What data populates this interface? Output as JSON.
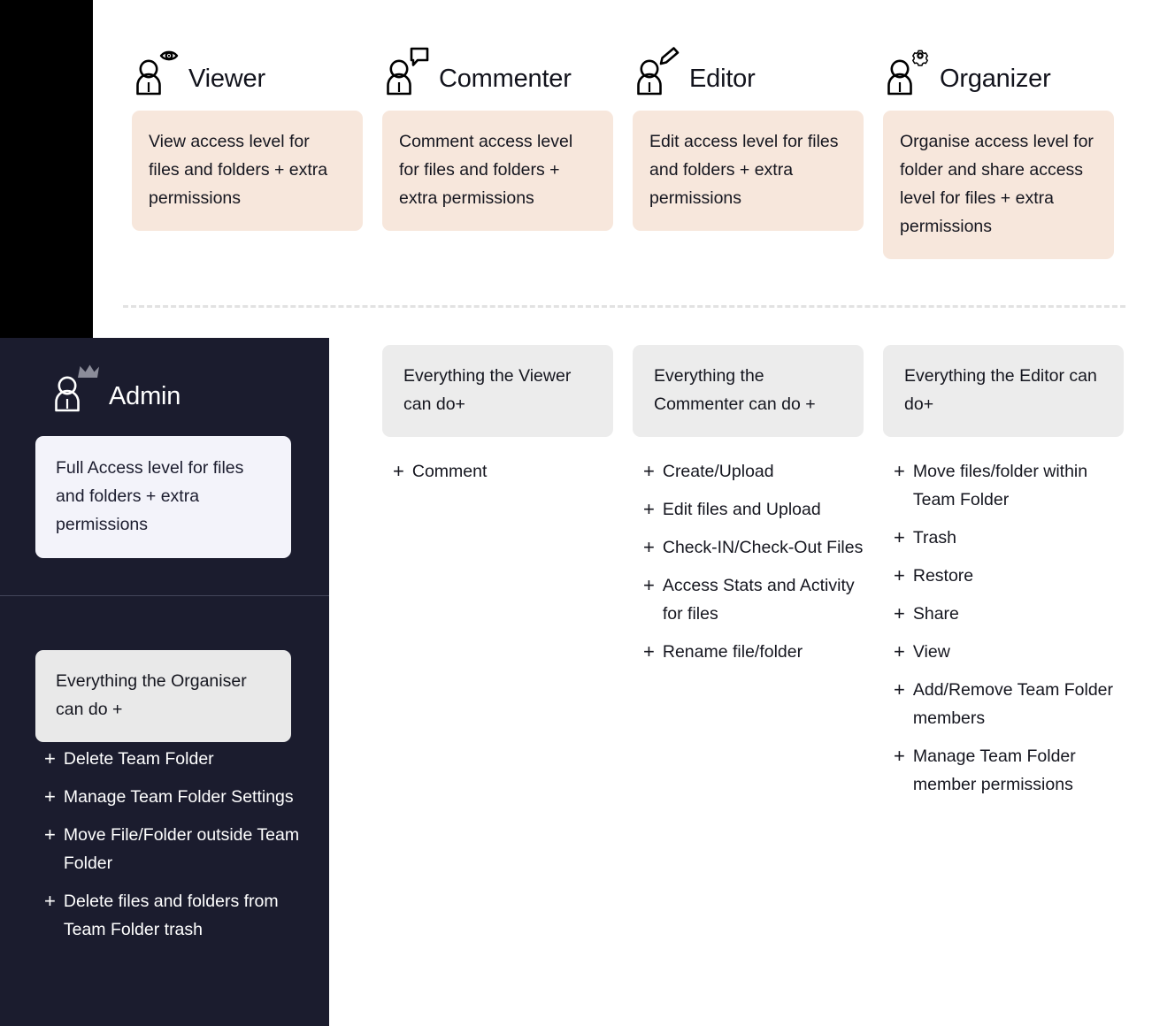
{
  "theme": {
    "black_block": "#000000",
    "panel_navy": "#1b1c2e",
    "peach_card": "#f7e7dc",
    "gray_card": "#ececec",
    "lavender_card": "#f3f3fa",
    "text_dark": "#15161f",
    "text_light": "#ffffff",
    "dashed_line": "#e2e2e2",
    "crown_gray": "#8b8c99"
  },
  "admin": {
    "icon": "person-crown-icon",
    "title": "Admin",
    "description": "Full Access level for files and folders + extra permissions",
    "inherits": "Everything the Organiser can do +",
    "permissions": [
      "Delete Team Folder",
      "Manage Team Folder Settings",
      "Move File/Folder outside Team Folder",
      "Delete files and folders from Team Folder trash"
    ]
  },
  "roles": [
    {
      "icon": "person-eye-icon",
      "title": "Viewer",
      "description": "View access level for files and folders + extra permissions"
    },
    {
      "icon": "person-comment-icon",
      "title": "Commenter",
      "description": "Comment access level for files and folders + extra permissions"
    },
    {
      "icon": "person-pencil-icon",
      "title": "Editor",
      "description": "Edit access level for files and folders + extra permissions"
    },
    {
      "icon": "person-gear-icon",
      "title": "Organizer",
      "description": "Organise access level for folder and share access level for files + extra permissions"
    }
  ],
  "lower_columns": [
    {
      "inherits": "Everything the Viewer can do+",
      "permissions": [
        "Comment"
      ]
    },
    {
      "inherits": "Everything the Commenter can do +",
      "permissions": [
        "Create/Upload",
        "Edit files and Upload",
        "Check-IN/Check-Out Files",
        "Access Stats and Activity for files",
        "Rename file/folder"
      ]
    },
    {
      "inherits": "Everything the Editor can do+",
      "permissions": [
        "Move files/folder within Team Folder",
        "Trash",
        "Restore",
        "Share",
        "View",
        "Add/Remove Team Folder members",
        "Manage Team Folder member permissions"
      ]
    }
  ],
  "plus_symbol": "+"
}
